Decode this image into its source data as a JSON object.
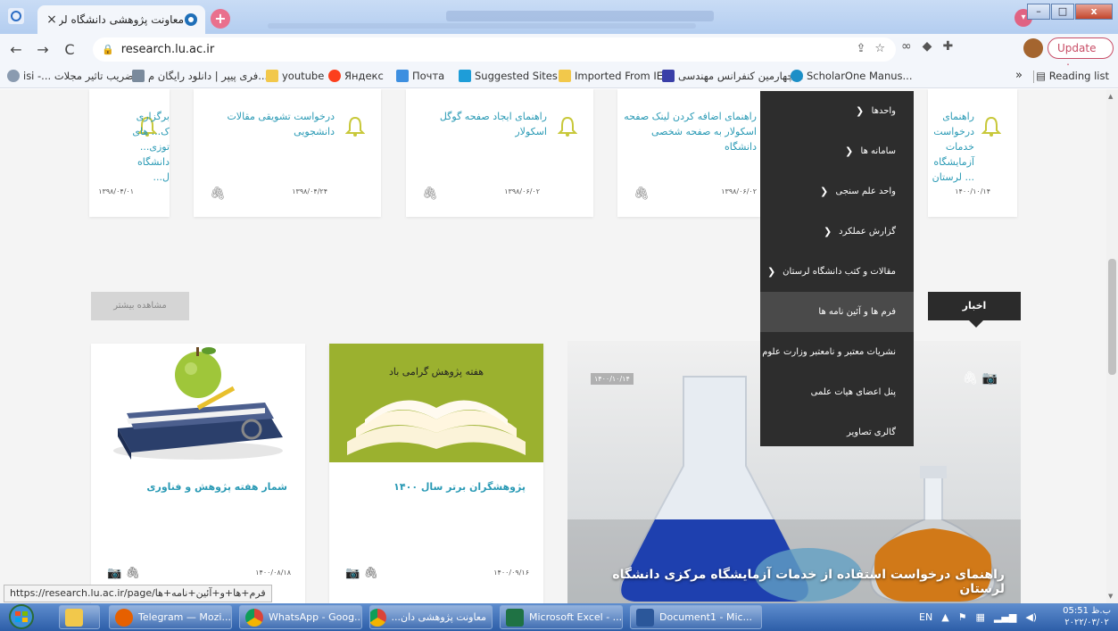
{
  "browser": {
    "tab_title": "معاونت پژوهشی دانشگاه لرستان",
    "tab_close": "×",
    "new_tab": "+",
    "url": "research.lu.ac.ir",
    "update_label": "Update",
    "update_menu": "⋮",
    "back": "←",
    "forward": "→",
    "reload": "C",
    "window_minimize": "–",
    "window_maximize": "□",
    "window_close": "x"
  },
  "bookmarks": {
    "items": [
      {
        "label": "isi -... ضریب تاثیر مجلات",
        "icon": "globe-icon"
      },
      {
        "label": "فری پیپر | دانلود رایگان م...",
        "icon": "freepaper-icon"
      },
      {
        "label": "youtube",
        "icon": "folder-icon"
      },
      {
        "label": "Яндекс",
        "icon": "yandex-icon"
      },
      {
        "label": "Почта",
        "icon": "mail-icon"
      },
      {
        "label": "Suggested Sites",
        "icon": "bing-icon"
      },
      {
        "label": "Imported From IE",
        "icon": "folder-icon"
      },
      {
        "label": "چهارمین کنفرانس مهندسی...",
        "icon": "a-icon"
      },
      {
        "label": "ScholarOne Manus...",
        "icon": "scholarone-icon"
      }
    ],
    "overflow": "»",
    "reading_list": "Reading list"
  },
  "cards": [
    {
      "title": "راهنمای درخواست خدمات آزمایشگاه ... لرستان",
      "date": "۱۴۰۰/۱۰/۱۴"
    },
    {
      "title": "راهنمای اضافه کردن لینک صفحه اسکولار به صفحه شخصی دانشگاه",
      "date": "۱۳۹۸/۰۶/۰۲"
    },
    {
      "title": "راهنمای ایجاد صفحه گوگل اسکولار",
      "date": "۱۳۹۸/۰۶/۰۲"
    },
    {
      "title": "درخواست تشویقی مقالات دانشجویی",
      "date": "۱۳۹۸/۰۴/۲۴"
    },
    {
      "title": "برگزاری ک... های توزی... دانشگاه ل...",
      "date": "۱۳۹۸/۰۴/۰۱"
    }
  ],
  "more_button": "مشاهده بیشتر",
  "news_button": "اخبار",
  "posts": [
    {
      "title": "شمار هفته پژوهش و فناوری",
      "date": "۱۴۰۰/۰۸/۱۸"
    },
    {
      "title": "پژوهشگران برتر سال ۱۴۰۰",
      "date": "۱۴۰۰/۰۹/۱۶",
      "image_caption": "هفته پژوهش گرامی باد"
    }
  ],
  "hero": {
    "title": "راهنمای درخواست استفاده از خدمات آزمایشگاه مرکزی دانشگاه لرستان",
    "date": "۱۴۰۰/۱۰/۱۴"
  },
  "menu": {
    "items": [
      {
        "label": "واحدها",
        "has_sub": true,
        "chevron": "❯"
      },
      {
        "label": "سامانه ها",
        "has_sub": true,
        "chevron": "❯"
      },
      {
        "label": "واحد علم سنجی",
        "has_sub": true,
        "chevron": "❯"
      },
      {
        "label": "گزارش عملکرد",
        "has_sub": true,
        "chevron": "❯"
      },
      {
        "label": "مقالات و کتب دانشگاه لرستان",
        "has_sub": true,
        "chevron": "❯"
      },
      {
        "label": "فرم ها و آئین نامه ها",
        "has_sub": false,
        "chevron": ""
      },
      {
        "label": "نشریات معتبر و نامعتبر وزارت علوم",
        "has_sub": false,
        "chevron": ""
      },
      {
        "label": "پنل اعضای هیات علمی",
        "has_sub": false,
        "chevron": ""
      },
      {
        "label": "گالری تصاویر",
        "has_sub": false,
        "chevron": ""
      }
    ],
    "active_index": 5
  },
  "status_url": "https://research.lu.ac.ir/page/فرم+ها+و+آئین+نامه+ها",
  "taskbar": {
    "items": [
      {
        "label": "Telegram — Mozi...",
        "color": "#e66000"
      },
      {
        "label": "WhatsApp - Goog...",
        "color": "#2e9d4b"
      },
      {
        "label": "معاونت پژوهشی دان...",
        "color": "#db4437"
      },
      {
        "label": "Microsoft Excel - ...",
        "color": "#1f7244"
      },
      {
        "label": "Document1 - Mic...",
        "color": "#2b579a"
      }
    ],
    "lang": "EN",
    "time": "05:51 ب.ظ",
    "date": "۲۰۲۲/۰۳/۰۲"
  },
  "colors": {
    "accent_teal": "#2a9ab5",
    "menu_bg": "#2d2d2d",
    "update_pink": "#c84d66",
    "bell_yellow": "#c8c83a"
  }
}
